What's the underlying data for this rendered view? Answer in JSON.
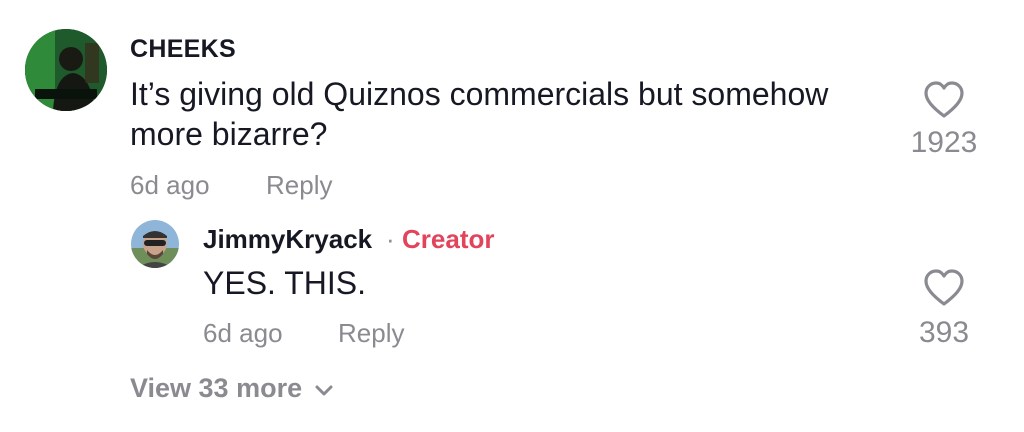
{
  "comments": {
    "main": {
      "username": "CHEEKS",
      "text": "It’s giving old Quiznos commercials but somehow more bizarre?",
      "date": "6d ago",
      "reply_label": "Reply",
      "likes": "1923",
      "avatar_icon": "avatar-dj-green"
    },
    "reply": {
      "username": "JimmyKryack",
      "separator": "·",
      "badge": "Creator",
      "text": "YES. THIS.",
      "date": "6d ago",
      "reply_label": "Reply",
      "likes": "393",
      "avatar_icon": "avatar-man-sunglasses"
    }
  },
  "view_more_label": "View 33 more",
  "colors": {
    "text": "#161823",
    "muted": "#8a8b91",
    "creator": "#e2445c"
  }
}
